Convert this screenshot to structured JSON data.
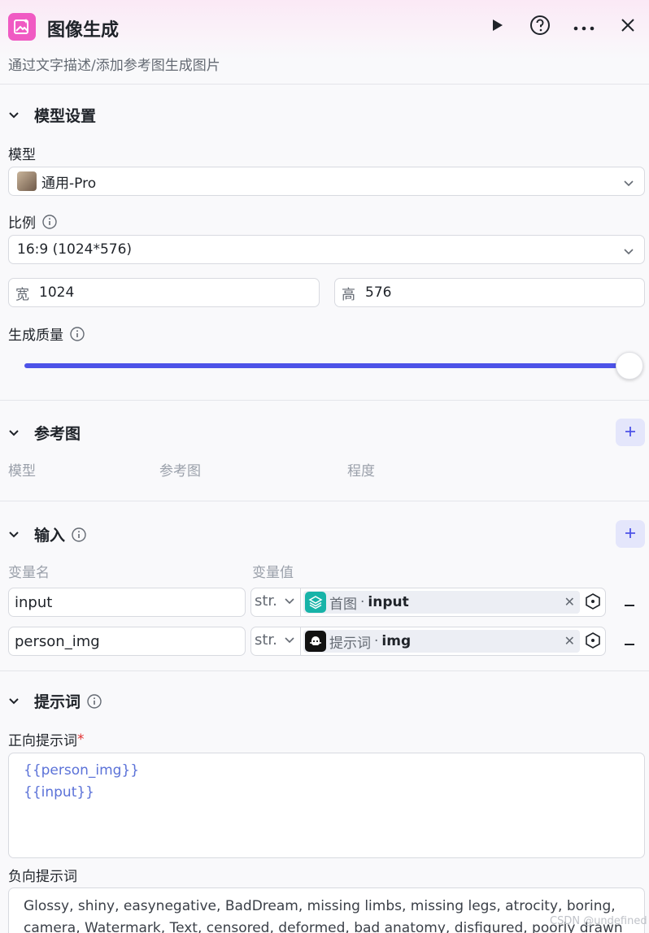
{
  "header": {
    "title": "图像生成",
    "subtitle": "通过文字描述/添加参考图生成图片",
    "icons": [
      "run-icon",
      "help-icon",
      "more-icon",
      "close-icon"
    ],
    "brand_color": "#f05ac3"
  },
  "model_settings": {
    "section_title": "模型设置",
    "model_label": "模型",
    "model_value": "通用-Pro",
    "ratio_label": "比例",
    "ratio_value": "16:9 (1024*576)",
    "width_prefix": "宽",
    "width_value": "1024",
    "height_prefix": "高",
    "height_value": "576",
    "quality_label": "生成质量",
    "quality_level": 1.0,
    "accent_color": "#4d53e8"
  },
  "reference": {
    "section_title": "参考图",
    "col_model": "模型",
    "col_image": "参考图",
    "col_degree": "程度"
  },
  "inputs": {
    "section_title": "输入",
    "col_name": "变量名",
    "col_value": "变量值",
    "rows": [
      {
        "name": "input",
        "type": "str.",
        "node": "首图",
        "sep": "·",
        "var": "input"
      },
      {
        "name": "person_img",
        "type": "str.",
        "node": "提示词",
        "sep": "·",
        "var": "img"
      }
    ]
  },
  "prompt": {
    "section_title": "提示词",
    "positive_label": "正向提示词",
    "required_mark": "*",
    "positive_line1": "{{person_img}}",
    "positive_line2": "{{input}}",
    "negative_label": "负向提示词",
    "negative_text": "Glossy, shiny, easynegative, BadDream, missing limbs, missing legs, atrocity, boring, camera, Watermark, Text, censored, deformed, bad anatomy, disfigured, poorly drawn face,"
  },
  "watermark": "CSDN @undefined"
}
